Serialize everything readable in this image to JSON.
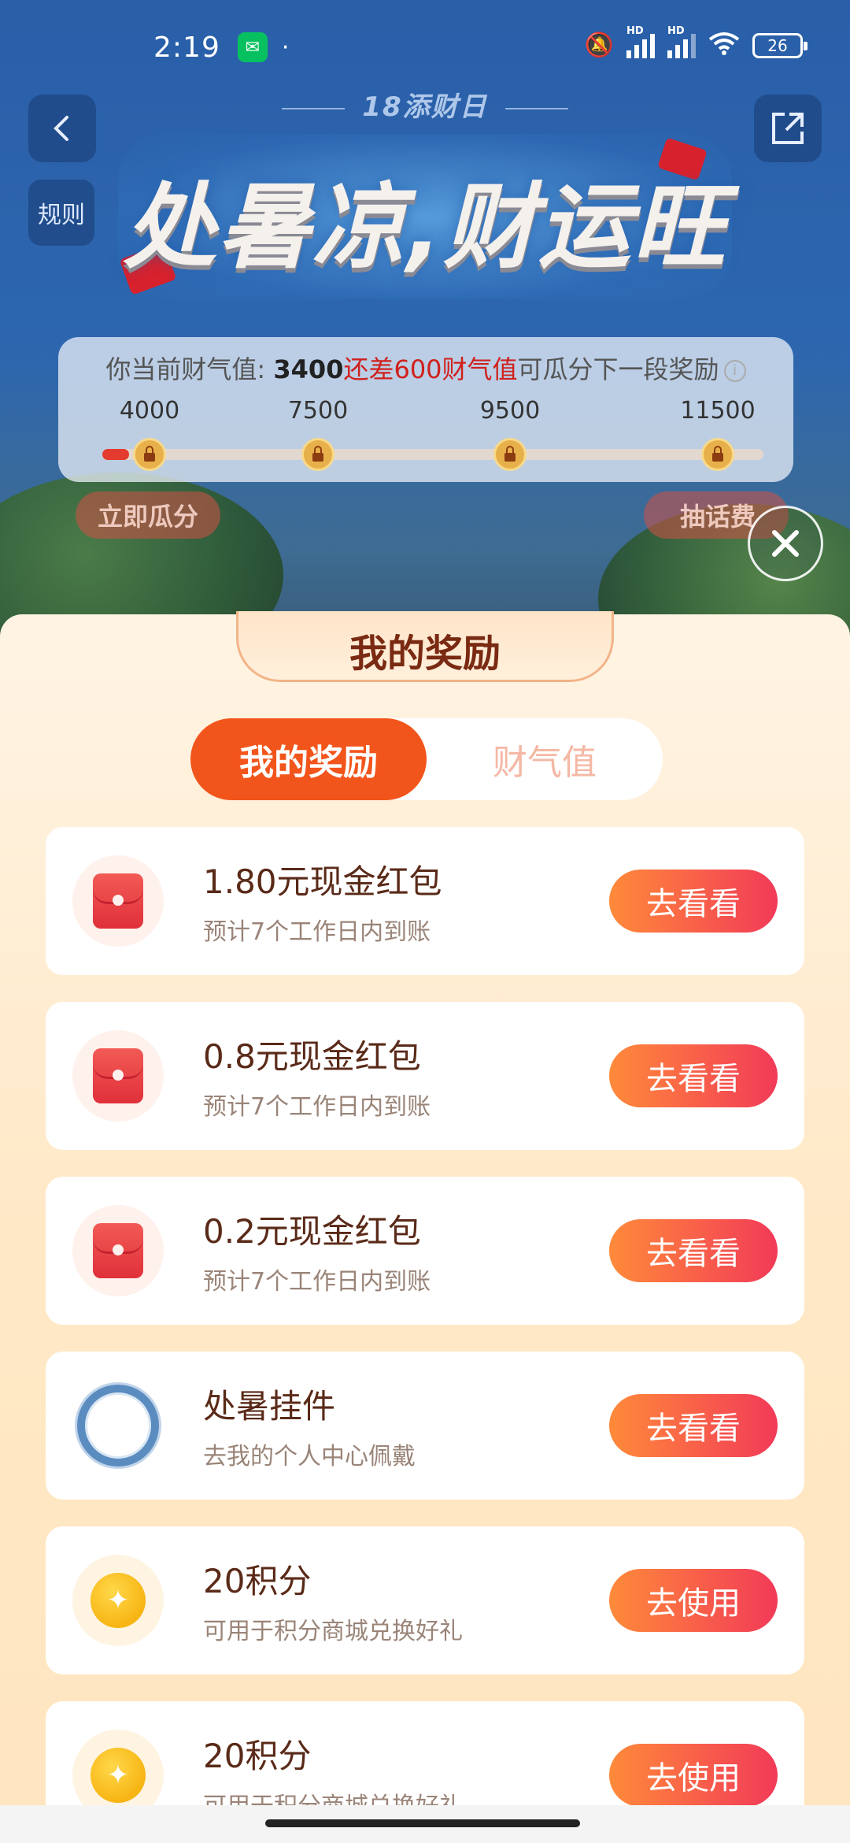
{
  "status_bar": {
    "time": "2:19",
    "dot": "·",
    "battery": "26",
    "signal_1_label": "HD",
    "signal_2_label": "HD",
    "icons": [
      "wechat-icon",
      "mute-icon",
      "signal-icon",
      "signal-icon",
      "wifi-icon",
      "battery-icon"
    ]
  },
  "header": {
    "rules_label": "规则",
    "event_subtitle": "18添财日",
    "banner_title": "处暑凉,财运旺",
    "back_icon": "chevron-left-icon",
    "share_icon": "share-icon"
  },
  "progress": {
    "prefix": "你当前财气值: ",
    "current_value": "3400",
    "gap_text": "还差600财气值",
    "suffix": "可瓜分下一段奖励",
    "fill_fraction": 0.04,
    "milestones": [
      {
        "label": "4000"
      },
      {
        "label": "7500"
      },
      {
        "label": "9500"
      },
      {
        "label": "11500"
      }
    ],
    "claim_label": "立即瓜分",
    "draw_label": "抽话费"
  },
  "sheet": {
    "title": "我的奖励",
    "tabs": [
      {
        "label": "我的奖励",
        "active": true
      },
      {
        "label": "财气值",
        "active": false
      }
    ],
    "rewards": [
      {
        "icon": "red-packet-icon",
        "title": "1.80元现金红包",
        "desc": "预计7个工作日内到账",
        "action": "去看看"
      },
      {
        "icon": "red-packet-icon",
        "title": "0.8元现金红包",
        "desc": "预计7个工作日内到账",
        "action": "去看看"
      },
      {
        "icon": "red-packet-icon",
        "title": "0.2元现金红包",
        "desc": "预计7个工作日内到账",
        "action": "去看看"
      },
      {
        "icon": "avatar-frame-icon",
        "title": "处暑挂件",
        "desc": "去我的个人中心佩戴",
        "action": "去看看"
      },
      {
        "icon": "points-coin-icon",
        "title": "20积分",
        "desc": "可用于积分商城兑换好礼",
        "action": "去使用"
      },
      {
        "icon": "points-coin-icon",
        "title": "20积分",
        "desc": "可用于积分商城兑换好礼",
        "action": "去使用"
      }
    ]
  },
  "colors": {
    "accent": "#f2551b",
    "button_gradient_start": "#ff8a3a",
    "button_gradient_end": "#f23a58",
    "highlight_red": "#d0201c"
  }
}
